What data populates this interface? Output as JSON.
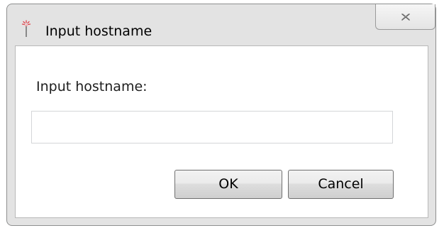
{
  "window": {
    "title": "Input hostname",
    "title_icon": "sparkle-torch-icon",
    "close_icon": "close-icon"
  },
  "form": {
    "prompt_label": "Input hostname:",
    "hostname_value": "",
    "hostname_placeholder": ""
  },
  "buttons": {
    "ok_label": "OK",
    "cancel_label": "Cancel"
  },
  "colors": {
    "window_frame": "#e3e3e3",
    "client_background": "#ffffff",
    "icon_accent": "#e0424a"
  }
}
